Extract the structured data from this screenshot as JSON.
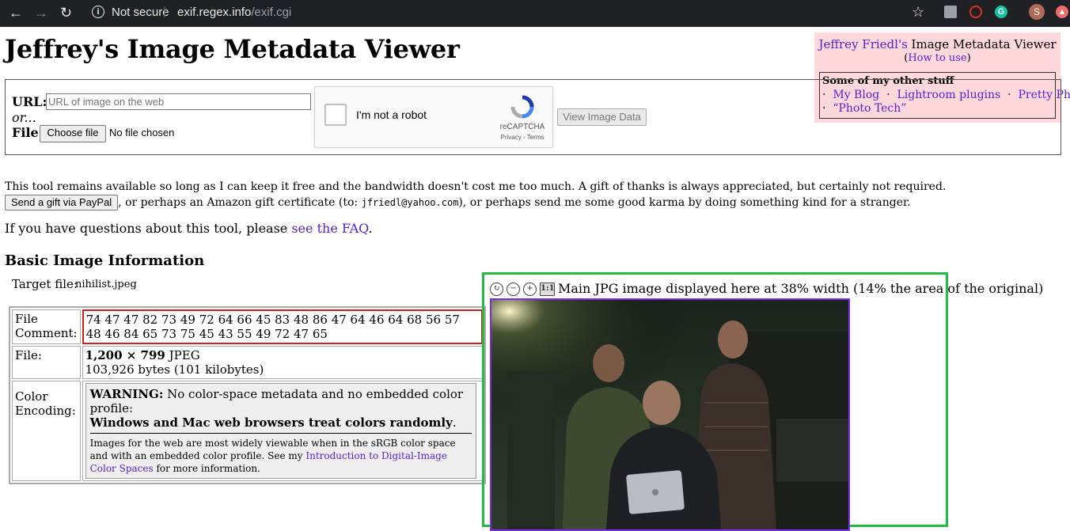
{
  "browser": {
    "security_label": "Not secure",
    "url_host": "exif.regex.info",
    "url_path": "/exif.cgi",
    "profile_initial": "S"
  },
  "page": {
    "title": "Jeffrey's Image Metadata Viewer"
  },
  "sidebox": {
    "author_link": "Jeffrey Friedl's",
    "title_rest": " Image Metadata Viewer",
    "how_to_use": "How to use",
    "other_heading": "Some of my other stuff",
    "links": [
      "My Blog",
      "Lightroom plugins",
      "Pretty Photos",
      "“Photo Tech”"
    ]
  },
  "form": {
    "url_label": "URL:",
    "url_placeholder": "URL of image on the web",
    "or_label": "or...",
    "file_label": "File:",
    "choose_file": "Choose file",
    "no_file": "No file chosen",
    "captcha_label": "I'm not a robot",
    "captcha_brand": "reCAPTCHA",
    "captcha_terms": "Privacy - Terms",
    "view_button": "View Image Data"
  },
  "notice": {
    "text1": "This tool remains available so long as I can keep it free and the bandwidth doesn't cost me too much. A gift of thanks is always appreciated, but certainly not required. ",
    "paypal_button": "Send a gift via PayPal",
    "text2": ", or perhaps an Amazon gift certificate (to: ",
    "email": "jfriedl@yahoo.com",
    "text3": "), or perhaps send me some good karma by doing something kind for a stranger.",
    "faq_text": "If you have questions about this tool, please ",
    "faq_link": "see the FAQ",
    "faq_end": "."
  },
  "basic": {
    "heading": "Basic Image Information",
    "target_label": "Target file:",
    "target_value": "nihilist.jpeg",
    "comment_label": "File Comment:",
    "comment_value": "74 47 47 82 73 49 72 64 66 45 83 48 86 47 64 46 64 68 56 57 48 46 84 65 73 75 45 43 55 49 72 47 65",
    "file_label": "File:",
    "dimensions": "1,200 × 799",
    "format": " JPEG",
    "bytes": "103,926 bytes (101 kilobytes)",
    "color_label": "Color Encoding:",
    "warning_bold": "WARNING:",
    "warning_text": " No color-space metadata and no embedded color profile:",
    "warning_bold2": "Windows and Mac web browsers treat colors randomly",
    "warning_end": ".",
    "note_text": "Images for the web are most widely viewable when in the sRGB color space and with an embedded color profile. See my ",
    "note_link": "Introduction to Digital-Image Color Spaces",
    "note_end": " for more information."
  },
  "image_panel": {
    "caption": "Main JPG image displayed here at 38% width (14% the area of the original)",
    "tool_one_to_one": "1:1"
  }
}
